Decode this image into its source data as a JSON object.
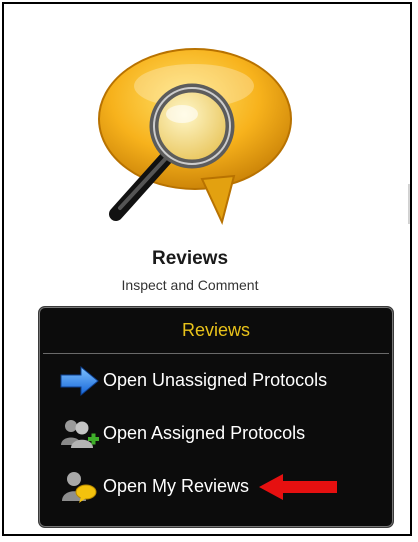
{
  "tile": {
    "title": "Reviews",
    "subtitle": "Inspect and Comment",
    "icon": "magnifier-speech-bubble-icon"
  },
  "menu": {
    "header": "Reviews",
    "header_color": "#e8c21a",
    "items": [
      {
        "label": "Open Unassigned Protocols",
        "icon": "blue-arrow-icon"
      },
      {
        "label": "Open Assigned Protocols",
        "icon": "assigned-users-icon"
      },
      {
        "label": "Open My Reviews",
        "icon": "my-reviews-user-icon"
      }
    ]
  },
  "annotation": {
    "icon": "red-arrow-icon",
    "color": "#e61010"
  }
}
